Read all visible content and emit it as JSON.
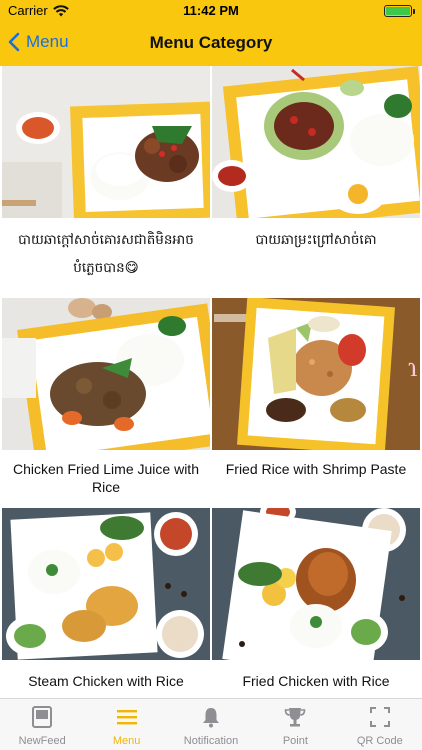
{
  "status_bar": {
    "carrier": "Carrier",
    "time": "11:42 PM",
    "battery_level": 1.0,
    "battery_color": "#3DC84A"
  },
  "nav": {
    "back_label": "Menu",
    "title": "Menu Category",
    "accent_color": "#F9C80E",
    "back_color": "#1A6FE0"
  },
  "items": [
    {
      "label": "បាយឆាក្តៅសាច់គោរសជាតិមិនអាចបំភ្លេចបាន😋",
      "image": "khmer-stir-fry-beef-with-rice"
    },
    {
      "label": "បាយឆាម្រះព្រៅសាច់គោ",
      "image": "basil-beef-with-rice-and-egg"
    },
    {
      "label": "Chicken Fried Lime Juice with Rice",
      "image": "chicken-fried-lime-juice-plate"
    },
    {
      "label": "Fried Rice with Shrimp Paste",
      "image": "shrimp-paste-fried-rice-plate"
    },
    {
      "label": "Steam Chicken with Rice",
      "image": "steam-chicken-rice-plate"
    },
    {
      "label": "Fried Chicken with Rice",
      "image": "fried-chicken-rice-plate"
    }
  ],
  "tabs": [
    {
      "label": "NewFeed",
      "icon": "newfeed-icon",
      "active": false
    },
    {
      "label": "Menu",
      "icon": "menu-icon",
      "active": true
    },
    {
      "label": "Notification",
      "icon": "bell-icon",
      "active": false
    },
    {
      "label": "Point",
      "icon": "trophy-icon",
      "active": false
    },
    {
      "label": "QR Code",
      "icon": "qr-scan-icon",
      "active": false
    }
  ]
}
